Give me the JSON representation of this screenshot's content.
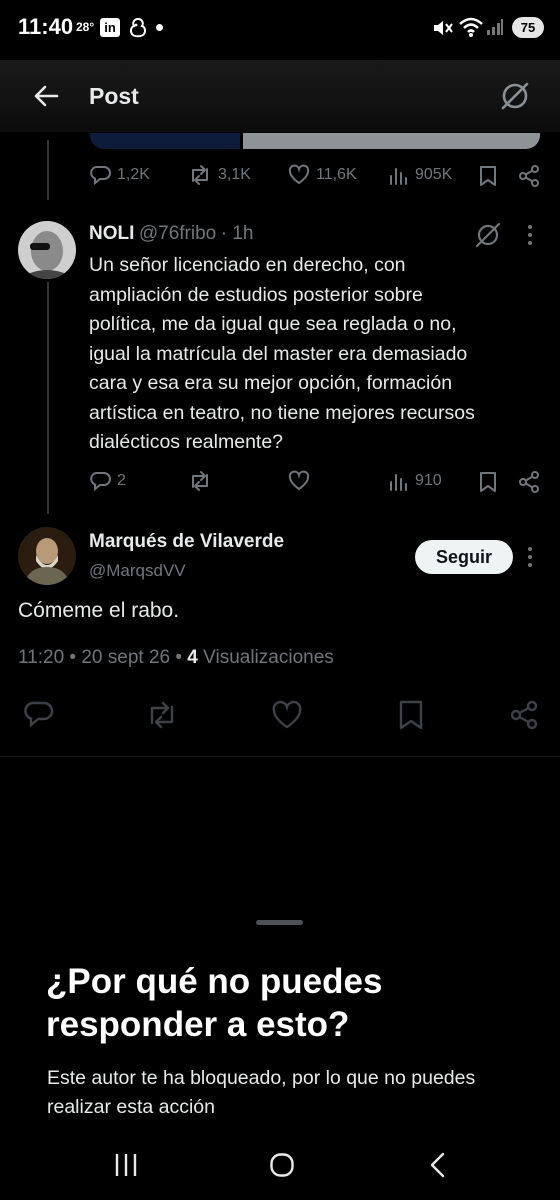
{
  "status_bar": {
    "time": "11:40",
    "temperature": "28°",
    "linkedin_badge": "in",
    "battery": "75"
  },
  "header": {
    "title": "Post"
  },
  "parent_post": {
    "stats": {
      "replies": "1,2K",
      "reposts": "3,1K",
      "likes": "11,6K",
      "views": "905K"
    }
  },
  "reply": {
    "author_name": "NOLI",
    "handle": "@76fribo",
    "time": "· 1h",
    "text_lines": [
      "Un señor licenciado en derecho, con",
      "ampliación de estudios posterior sobre",
      "política, me da igual que sea reglada o no,",
      "igual la matrícula del master era demasiado",
      "cara y esa era su mejor opción, formación",
      "artística en teatro, no tiene mejores recursos",
      "dialécticos realmente?"
    ],
    "stats": {
      "replies": "2",
      "views": "910"
    }
  },
  "main_post": {
    "author_name": "Marqués de Vilaverde",
    "handle": "@MarqsdVV",
    "follow_label": "Seguir",
    "text": "Cómeme el rabo.",
    "meta_time": "11:20 • 20 sept 26 •",
    "meta_views_count": "4",
    "meta_views_label": "Visualizaciones"
  },
  "sheet": {
    "title": "¿Por qué no puedes responder a esto?",
    "body": "Este autor te ha bloqueado, por lo que no puedes realizar esta acción"
  },
  "colors": {
    "background": "#000000",
    "text_primary": "#e7e9ea",
    "text_secondary": "#71767b",
    "follow_button_bg": "#eff3f4"
  }
}
